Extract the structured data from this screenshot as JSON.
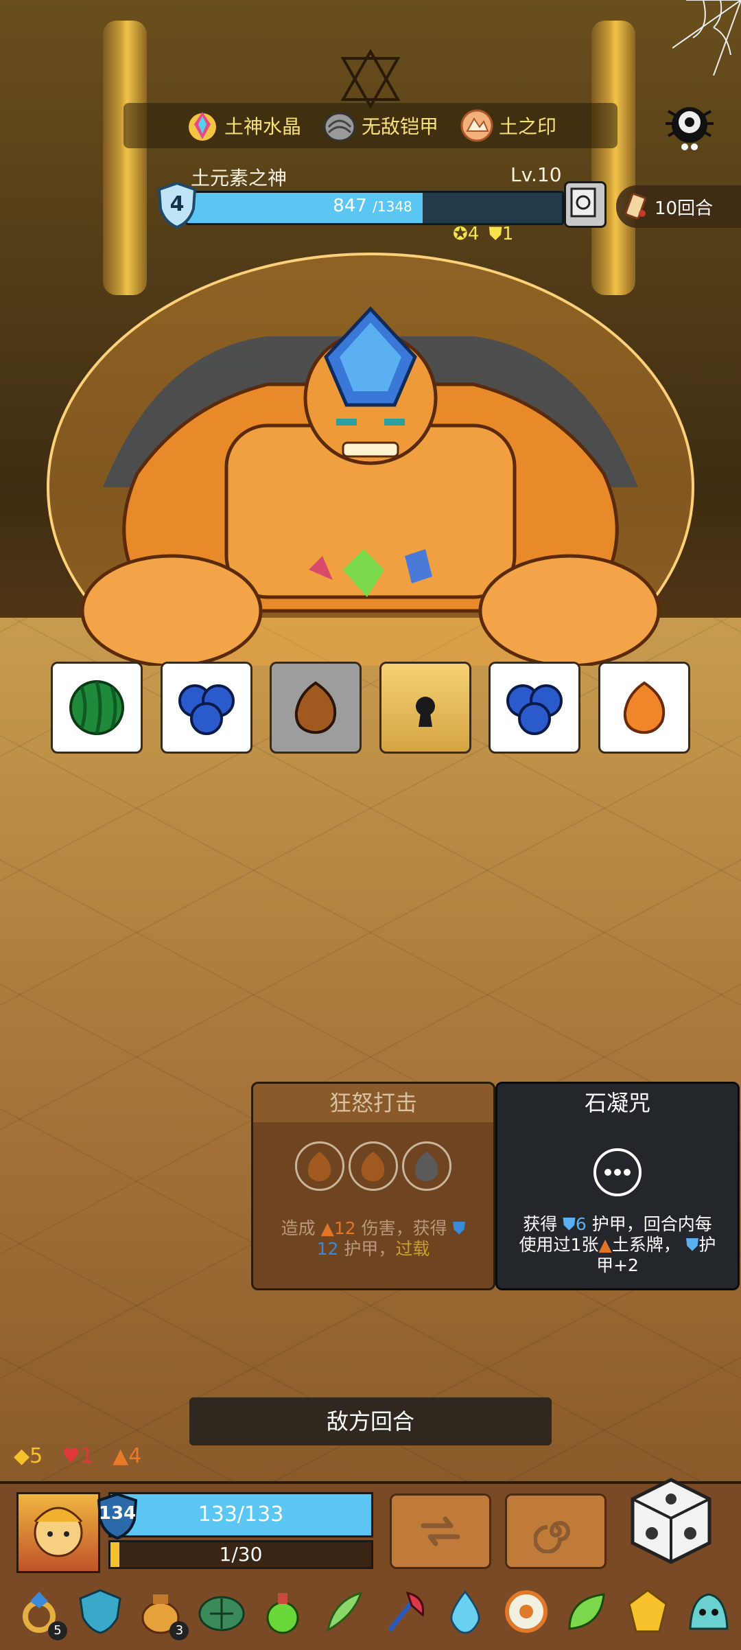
{
  "artifacts": [
    {
      "name": "土神水晶",
      "icon": "crystal-icon"
    },
    {
      "name": "无敌铠甲",
      "icon": "armor-icon"
    },
    {
      "name": "土之印",
      "icon": "earth-seal-icon"
    }
  ],
  "boss": {
    "name": "土元素之神",
    "level": "Lv.10",
    "shield": "4",
    "hp_current": "847",
    "hp_max": "/1348",
    "hp_fraction": 0.628,
    "status": [
      {
        "icon": "rage-icon",
        "value": "4"
      },
      {
        "icon": "shield-status-icon",
        "value": "1"
      }
    ]
  },
  "round": {
    "text": "10回合"
  },
  "intent_dice": [
    {
      "kind": "green-watermelon-icon"
    },
    {
      "kind": "blueberry-icon"
    },
    {
      "kind": "seed-icon-grey"
    },
    {
      "kind": "lock-icon"
    },
    {
      "kind": "blueberry-icon"
    },
    {
      "kind": "seed-icon-orange"
    }
  ],
  "skills": [
    {
      "title": "狂怒打击",
      "desc_1": "造成",
      "damage": "12",
      "desc_2": "伤害，获得",
      "armor": "12",
      "desc_3": "护甲，",
      "keyword": "过载"
    },
    {
      "title": "石凝咒",
      "line1_a": "获得",
      "line1_armor": "6",
      "line1_b": "护甲，回合内每",
      "line2_a": "使用过1张",
      "line2_b": "土系牌，",
      "line2_c": "护",
      "line3": "甲+2"
    }
  ],
  "enemy_turn": "敌方回合",
  "player_stats": [
    {
      "icon": "gold-diamond-icon",
      "value": "5",
      "color": "#f6c12a"
    },
    {
      "icon": "heart-icon",
      "value": "1",
      "color": "#e0393a"
    },
    {
      "icon": "fire-icon",
      "value": "4",
      "color": "#e77a2b"
    }
  ],
  "player": {
    "shield": "134",
    "hp": "133/133",
    "xp": "1/30",
    "xp_fraction": 0.033
  },
  "relics": [
    {
      "icon": "ring-icon",
      "count": "5"
    },
    {
      "icon": "ice-shield-icon",
      "count": ""
    },
    {
      "icon": "gold-sack-icon",
      "count": "3"
    },
    {
      "icon": "turtle-shell-icon",
      "count": ""
    },
    {
      "icon": "potion-icon",
      "count": ""
    },
    {
      "icon": "feather-icon",
      "count": ""
    },
    {
      "icon": "axe-icon",
      "count": ""
    },
    {
      "icon": "water-drop-icon",
      "count": ""
    },
    {
      "icon": "donut-icon",
      "count": ""
    },
    {
      "icon": "leaf-icon",
      "count": ""
    },
    {
      "icon": "gold-gem-icon",
      "count": ""
    },
    {
      "icon": "slime-icon",
      "count": ""
    }
  ],
  "colors": {
    "hp_blue": "#5cc6f2",
    "gold": "#f6c12a",
    "card_brown": "#6f4420",
    "card_dark": "#23272b"
  }
}
